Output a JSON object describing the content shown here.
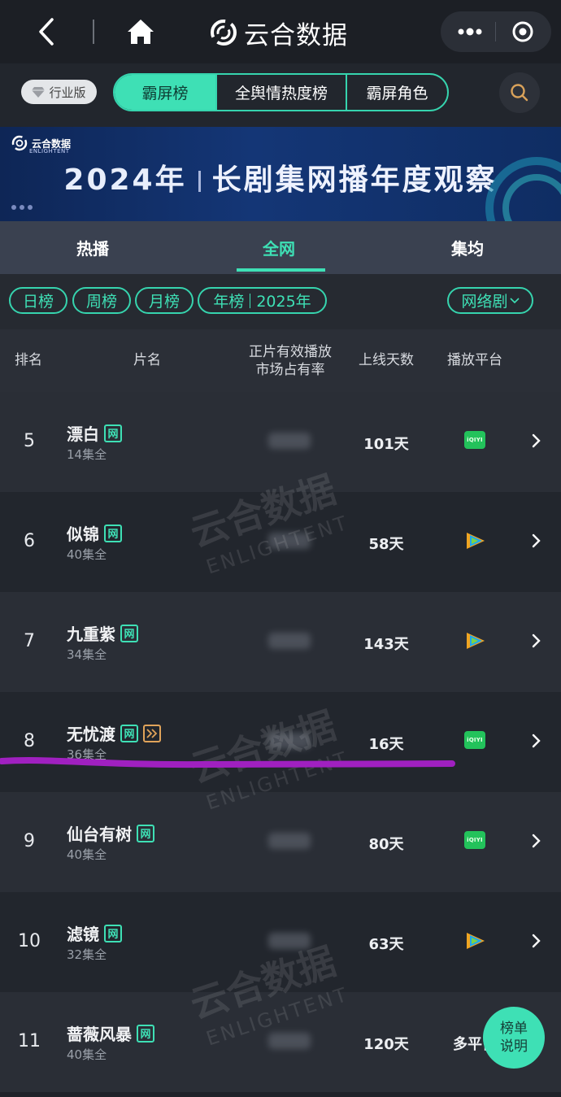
{
  "topbar": {
    "title": "云合数据"
  },
  "subheader": {
    "industry_badge": "行业版",
    "segments": [
      "霸屏榜",
      "全舆情热度榜",
      "霸屏角色"
    ]
  },
  "banner": {
    "brand_cn": "云合数据",
    "brand_en": "ENLIGHTENT",
    "year": "2024年",
    "title": "长剧集网播年度观察"
  },
  "tabs": [
    "热播",
    "全网",
    "集均"
  ],
  "filters": {
    "day": "日榜",
    "week": "周榜",
    "month": "月榜",
    "year": "年榜",
    "year_value": "2025年",
    "type": "网络剧"
  },
  "table_header": {
    "rank": "排名",
    "title": "片名",
    "share_line1": "正片有效播放",
    "share_line2": "市场占有率",
    "days": "上线天数",
    "platform": "播放平台"
  },
  "rows": [
    {
      "rank": "5",
      "name": "漂白",
      "tag": "网",
      "episodes": "14集全",
      "days": "101天",
      "platform": "iqiyi"
    },
    {
      "rank": "6",
      "name": "似锦",
      "tag": "网",
      "episodes": "40集全",
      "days": "58天",
      "platform": "tencent"
    },
    {
      "rank": "7",
      "name": "九重紫",
      "tag": "网",
      "episodes": "34集全",
      "days": "143天",
      "platform": "tencent"
    },
    {
      "rank": "8",
      "name": "无忧渡",
      "tag": "网",
      "episodes": "36集全",
      "days": "16天",
      "platform": "iqiyi",
      "fast_forward": true
    },
    {
      "rank": "9",
      "name": "仙台有树",
      "tag": "网",
      "episodes": "40集全",
      "days": "80天",
      "platform": "iqiyi"
    },
    {
      "rank": "10",
      "name": "滤镜",
      "tag": "网",
      "episodes": "32集全",
      "days": "63天",
      "platform": "tencent"
    },
    {
      "rank": "11",
      "name": "蔷薇风暴",
      "tag": "网",
      "episodes": "40集全",
      "days": "120天",
      "platform_text": "多平台"
    }
  ],
  "float_button": {
    "line1": "榜单",
    "line2": "说明"
  },
  "icons": {
    "iqiyi_label": "iQIYI"
  },
  "colors": {
    "accent": "#3ee0b5",
    "marker": "#a020c0",
    "iqiyi": "#23c25b"
  }
}
